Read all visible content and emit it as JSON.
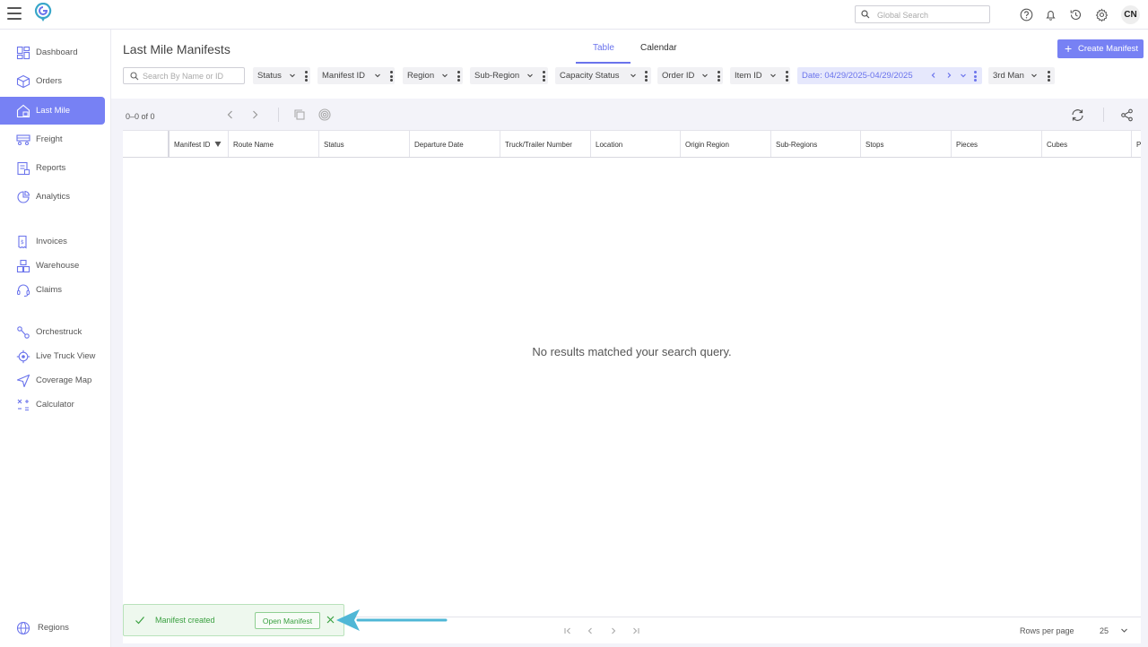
{
  "topbar": {
    "search_placeholder": "Global Search",
    "avatar_initials": "CN",
    "icons": [
      "help-icon",
      "bell-icon",
      "history-icon",
      "gear-icon"
    ]
  },
  "sidebar": {
    "items": [
      {
        "label": "Dashboard",
        "icon": "dashboard-icon"
      },
      {
        "label": "Orders",
        "icon": "box-icon"
      },
      {
        "label": "Last Mile",
        "icon": "house-box-icon",
        "active": true
      },
      {
        "label": "Freight",
        "icon": "truck-icon"
      },
      {
        "label": "Reports",
        "icon": "report-icon"
      },
      {
        "label": "Analytics",
        "icon": "analytics-icon"
      },
      {
        "label": "Invoices",
        "icon": "invoice-icon"
      },
      {
        "label": "Warehouse",
        "icon": "warehouse-icon"
      },
      {
        "label": "Claims",
        "icon": "headset-icon"
      },
      {
        "label": "Orchestruck",
        "icon": "route-icon"
      },
      {
        "label": "Live Truck View",
        "icon": "locate-icon"
      },
      {
        "label": "Coverage Map",
        "icon": "navigation-icon"
      },
      {
        "label": "Calculator",
        "icon": "calculator-icon"
      },
      {
        "label": "Regions",
        "icon": "globe-icon"
      }
    ]
  },
  "main": {
    "title": "Last Mile Manifests",
    "tabs": [
      {
        "label": "Table",
        "active": true
      },
      {
        "label": "Calendar",
        "active": false
      }
    ],
    "create_button": "Create Manifest",
    "search_placeholder": "Search By Name or ID",
    "filters": [
      {
        "label": "Status"
      },
      {
        "label": "Manifest ID"
      },
      {
        "label": "Region"
      },
      {
        "label": "Sub-Region"
      },
      {
        "label": "Capacity Status"
      },
      {
        "label": "Order ID"
      },
      {
        "label": "Item ID"
      },
      {
        "label": "Date: 04/29/2025-04/29/2025",
        "active": true
      },
      {
        "label": "3rd Man"
      }
    ]
  },
  "grid": {
    "range": "0–0 of 0",
    "columns": [
      "Manifest ID",
      "Route Name",
      "Status",
      "Departure Date",
      "Truck/Trailer Number",
      "Location",
      "Origin Region",
      "Sub-Regions",
      "Stops",
      "Pieces",
      "Cubes",
      "P"
    ],
    "empty_message": "No results matched your search query.",
    "rows_per_page_label": "Rows per page",
    "rows_per_page_value": "25"
  },
  "toast": {
    "message": "Manifest created",
    "button": "Open Manifest"
  },
  "colors": {
    "accent": "#7781f4",
    "success": "#3aa040",
    "arrow": "#4fb7d6"
  }
}
